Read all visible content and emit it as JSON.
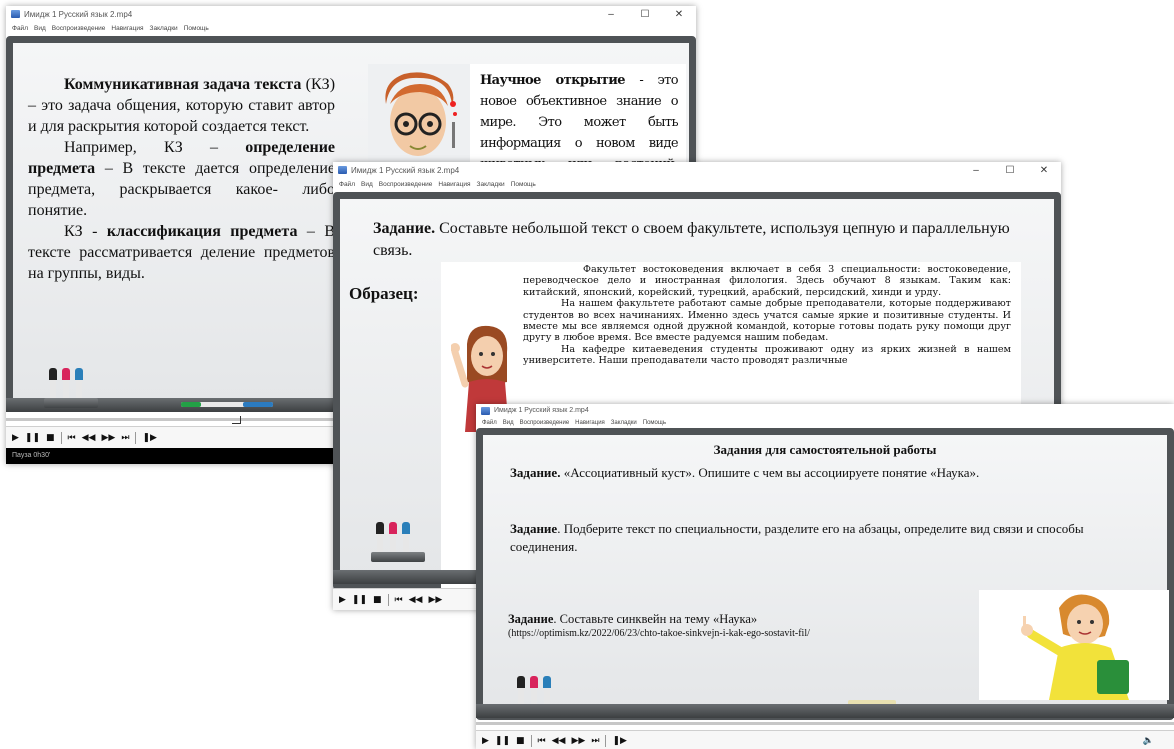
{
  "windows": [
    {
      "title": "Имидж 1 Русский язык 2.mp4",
      "menu": [
        "Файл",
        "Вид",
        "Воспроизведение",
        "Навигация",
        "Закладки",
        "Помощь"
      ],
      "status": "Пауза 0h30'"
    },
    {
      "title": "Имидж 1 Русский язык 2.mp4",
      "menu": [
        "Файл",
        "Вид",
        "Воспроизведение",
        "Навигация",
        "Закладки",
        "Помощь"
      ]
    },
    {
      "title": "Имидж 1 Русский язык 2.mp4",
      "menu": [
        "Файл",
        "Вид",
        "Воспроизведение",
        "Навигация",
        "Закладки",
        "Помощь"
      ]
    }
  ],
  "slide1": {
    "p1_bold": "Коммуникативная задача текста",
    "p1_rest": "(КЗ) – это задача общения, которую ставит автор и для раскрытия которой создается текст.",
    "p2_start": "Например, КЗ –",
    "p2_bold": "определение предмета",
    "p2_rest": "– В тексте дается определение предмета, раскрывается какое- либо понятие.",
    "p3_start": "КЗ -",
    "p3_bold": "классификация предмета",
    "p3_rest": "– В тексте рассматривается деление предметов на группы, виды.",
    "card_bold": "Научное открытие",
    "card_rest": "- это новое объективное знание о мире. Это может быть информация о новом виде животных или растений, других континентах, причинах тех или"
  },
  "slide2": {
    "task_bold": "Задание.",
    "task_rest": "Составьте небольшой текст о своем факультете, используя цепную и параллельную связь.",
    "sample_label": "Образец:",
    "sample_p1": "Факультет востоковедения включает в себя 3 специальности: востоковедение, переводческое дело и иностранная филология. Здесь обучают 8 языкам. Таким как: китайский, японский, корейский, турецкий, арабский, персидский, хинди и урду.",
    "sample_p2": "На нашем факультете работают самые добрые преподаватели, которые поддерживают студентов во всех начинаниях. Именно здесь учатся самые яркие и позитивные студенты. И вместе мы все являемся одной дружной командой, которые готовы подать руку помощи друг другу в любое время. Все вместе радуемся нашим победам.",
    "sample_p3": "На кафедре китаеведения студенты проживают одну из ярких жизней в нашем университете. Наши преподаватели часто проводят различные"
  },
  "slide3": {
    "heading": "Задания для самостоятельной работы",
    "t1_bold": "Задание.",
    "t1_rest": "«Ассоциативный куст». Опишите с чем вы ассоциируете понятие «Наука».",
    "t2_bold": "Задание",
    "t2_rest": ". Подберите текст по специальности, разделите его на абзацы, определите вид связи и способы соединения.",
    "t3_bold": "Задание",
    "t3_rest": ". Составьте синквейн на тему «Наука»",
    "link": "(https://optimism.kz/2022/06/23/chto-takoe-sinkvejn-i-kak-ego-sostavit-fil/"
  },
  "icons": [
    "play-icon",
    "pause-icon",
    "stop-icon",
    "prev-icon",
    "rewind-icon",
    "forward-icon",
    "next-icon",
    "frame-step-icon",
    "volume-icon"
  ]
}
